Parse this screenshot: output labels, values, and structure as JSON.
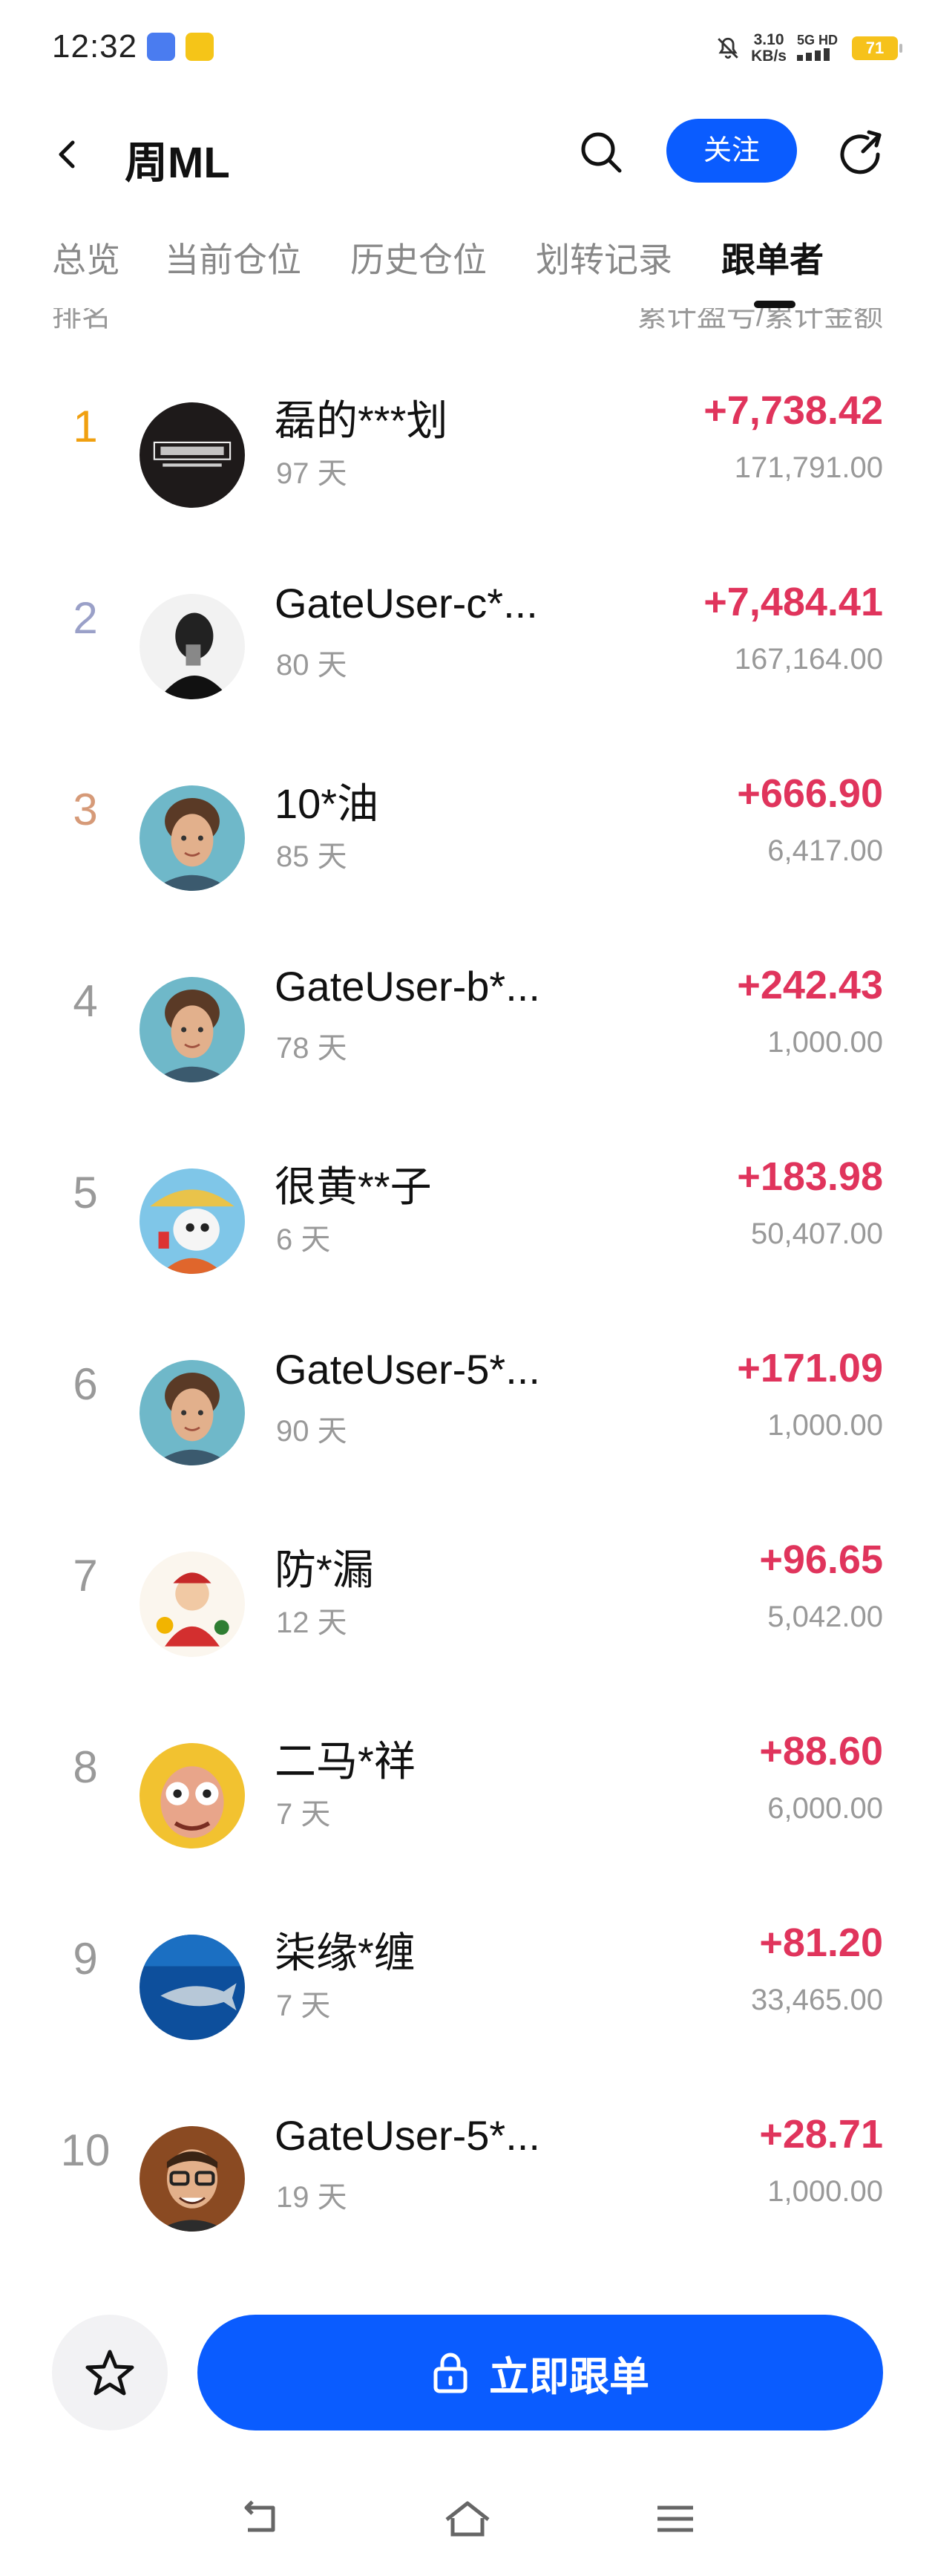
{
  "status_bar": {
    "time": "12:32",
    "net_speed_value": "3.10",
    "net_speed_unit": "KB/s",
    "network": "5G HD",
    "battery": "71"
  },
  "header": {
    "title": "周ML",
    "follow_label": "关注"
  },
  "tabs": [
    {
      "label": "总览",
      "active": false
    },
    {
      "label": "当前仓位",
      "active": false
    },
    {
      "label": "历史仓位",
      "active": false
    },
    {
      "label": "划转记录",
      "active": false
    },
    {
      "label": "跟单者",
      "active": true
    }
  ],
  "column_header": {
    "left": "排名",
    "right": "累计盈亏/累计金额"
  },
  "followers": [
    {
      "rank": "1",
      "name": "磊的***划",
      "days": "97 天",
      "pnl": "+7,738.42",
      "amount": "171,791.00",
      "rank_color": "#f0a010",
      "avatar": "finance-planner-logo"
    },
    {
      "rank": "2",
      "name": "GateUser-c*...",
      "days": "80 天",
      "pnl": "+7,484.41",
      "amount": "167,164.00",
      "rank_color": "#9aa0c8",
      "avatar": "bw-portrait"
    },
    {
      "rank": "3",
      "name": "10*油",
      "days": "85 天",
      "pnl": "+666.90",
      "amount": "6,417.00",
      "rank_color": "#d69a78",
      "avatar": "default-face"
    },
    {
      "rank": "4",
      "name": "GateUser-b*...",
      "days": "78 天",
      "pnl": "+242.43",
      "amount": "1,000.00",
      "rank_color": "#999999",
      "avatar": "default-face"
    },
    {
      "rank": "5",
      "name": "很黄**子",
      "days": "6 天",
      "pnl": "+183.98",
      "amount": "50,407.00",
      "rank_color": "#999999",
      "avatar": "cartoon-character"
    },
    {
      "rank": "6",
      "name": "GateUser-5*...",
      "days": "90 天",
      "pnl": "+171.09",
      "amount": "1,000.00",
      "rank_color": "#999999",
      "avatar": "default-face"
    },
    {
      "rank": "7",
      "name": "防*漏",
      "days": "12 天",
      "pnl": "+96.65",
      "amount": "5,042.00",
      "rank_color": "#999999",
      "avatar": "fortune-god"
    },
    {
      "rank": "8",
      "name": "二马*祥",
      "days": "7 天",
      "pnl": "+88.60",
      "amount": "6,000.00",
      "rank_color": "#999999",
      "avatar": "funny-face"
    },
    {
      "rank": "9",
      "name": "柒缘*缠",
      "days": "7 天",
      "pnl": "+81.20",
      "amount": "33,465.00",
      "rank_color": "#999999",
      "avatar": "ocean-fish"
    },
    {
      "rank": "10",
      "name": "GateUser-5*...",
      "days": "19 天",
      "pnl": "+28.71",
      "amount": "1,000.00",
      "rank_color": "#999999",
      "avatar": "glasses-man"
    }
  ],
  "bottom": {
    "cta_label": "立即跟单"
  },
  "colors": {
    "accent": "#0a5cff",
    "profit": "#e0345c",
    "muted": "#999999"
  }
}
